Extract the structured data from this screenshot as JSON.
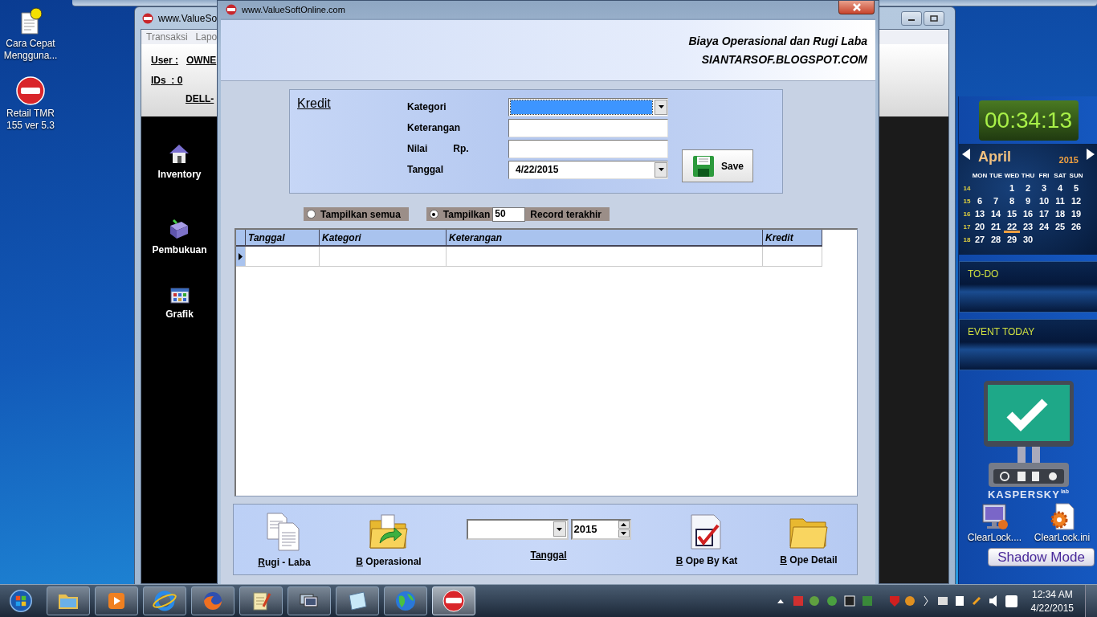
{
  "desktop_icons": [
    {
      "label": "Cara Cepat Mengguna...",
      "kind": "help"
    },
    {
      "label": "Retail TMR 155 ver 5.3",
      "kind": "app"
    }
  ],
  "main_window": {
    "title": "www.ValueSo",
    "menu": [
      "Transaksi",
      "Lapo"
    ],
    "user_label": "User :",
    "user_value": "OWNE",
    "ids_label": "IDs  : 0",
    "host": "DELL-",
    "sidebar": [
      {
        "label": "Inventory",
        "kind": "house"
      },
      {
        "label": "Pembukuan",
        "kind": "book"
      },
      {
        "label": "Grafik",
        "kind": "grid"
      }
    ]
  },
  "form_window": {
    "title": "www.ValueSoftOnline.com",
    "heading": "Biaya Operasional dan Rugi Laba",
    "site": "SIANTARSOF.BLOGSPOT.COM",
    "entry": {
      "title": "Kredit",
      "save": "Save",
      "fields": [
        {
          "label": "Kategori",
          "kind": "combo",
          "selected": true
        },
        {
          "label": "Keterangan",
          "kind": "text"
        },
        {
          "label": "Nilai",
          "unit": "Rp.",
          "kind": "text"
        },
        {
          "label": "Tanggal",
          "kind": "combo",
          "value": "4/22/2015",
          "selected": false
        }
      ]
    },
    "filter": [
      {
        "label": "Tampilkan semua",
        "selected": false
      },
      {
        "label": "Tampilkan",
        "count": "50",
        "suffix": "Record terakhir",
        "selected": true
      }
    ],
    "table": {
      "columns": [
        "Tanggal",
        "Kategori",
        "Keterangan",
        "Kredit"
      ]
    },
    "toolbar": [
      {
        "kind": "pages",
        "label": "Rugi - Laba"
      },
      {
        "kind": "folder-arrow",
        "label": "B Operasional"
      },
      {
        "kind": "period",
        "year": "2015",
        "label": "Tanggal"
      },
      {
        "kind": "checklist",
        "label": "B Ope By Kat"
      },
      {
        "kind": "folder",
        "label": "B Ope Detail"
      }
    ]
  },
  "gadgets": {
    "clock": "00:34:13",
    "calendar": {
      "month": "April",
      "year": "2015",
      "weekdays": [
        "MON",
        "TUE",
        "WED",
        "THU",
        "FRI",
        "SAT",
        "SUN"
      ],
      "weeks": [
        {
          "number": "14",
          "days": [
            {
              "day": "1",
              "today": false
            },
            {
              "day": "2",
              "today": false
            },
            {
              "day": "3",
              "today": false
            },
            {
              "day": "4",
              "today": false
            },
            {
              "day": "5",
              "today": false
            }
          ]
        },
        {
          "number": "15",
          "days": [
            {
              "day": "6",
              "today": false
            },
            {
              "day": "7",
              "today": false
            },
            {
              "day": "8",
              "today": false
            },
            {
              "day": "9",
              "today": false
            },
            {
              "day": "10",
              "today": false
            },
            {
              "day": "11",
              "today": false
            },
            {
              "day": "12",
              "today": false
            }
          ]
        },
        {
          "number": "16",
          "days": [
            {
              "day": "13",
              "today": false
            },
            {
              "day": "14",
              "today": false
            },
            {
              "day": "15",
              "today": false
            },
            {
              "day": "16",
              "today": false
            },
            {
              "day": "17",
              "today": false
            },
            {
              "day": "18",
              "today": false
            },
            {
              "day": "19",
              "today": false
            }
          ]
        },
        {
          "number": "17",
          "days": [
            {
              "day": "20",
              "today": false
            },
            {
              "day": "21",
              "today": false
            },
            {
              "day": "22",
              "today": true
            },
            {
              "day": "23",
              "today": false
            },
            {
              "day": "24",
              "today": false
            },
            {
              "day": "25",
              "today": false
            },
            {
              "day": "26",
              "today": false
            }
          ]
        },
        {
          "number": "18",
          "days": [
            {
              "day": "27",
              "today": false
            },
            {
              "day": "28",
              "today": false
            },
            {
              "day": "29",
              "today": false
            },
            {
              "day": "30",
              "today": false
            }
          ]
        }
      ]
    },
    "todo": "TO-DO",
    "event": "EVENT TODAY",
    "antivirus": {
      "brand": "KASPERSKY",
      "suffix": "lab"
    },
    "shortcuts": [
      {
        "label": "ClearLock....",
        "kind": "monitor"
      },
      {
        "label": "ClearLock.ini",
        "kind": "settings"
      }
    ],
    "shadow_mode": "Shadow Mode"
  },
  "taskbar": {
    "apps": [
      {
        "kind": "folder",
        "selected": false
      },
      {
        "kind": "media",
        "selected": false
      },
      {
        "kind": "ie",
        "selected": false
      },
      {
        "kind": "firefox",
        "selected": false
      },
      {
        "kind": "notepad",
        "selected": false
      },
      {
        "kind": "windows",
        "selected": false
      },
      {
        "kind": "note",
        "selected": false
      },
      {
        "kind": "globe",
        "selected": false
      },
      {
        "kind": "app",
        "selected": true
      }
    ],
    "time": "12:34 AM",
    "date": "4/22/2015"
  }
}
